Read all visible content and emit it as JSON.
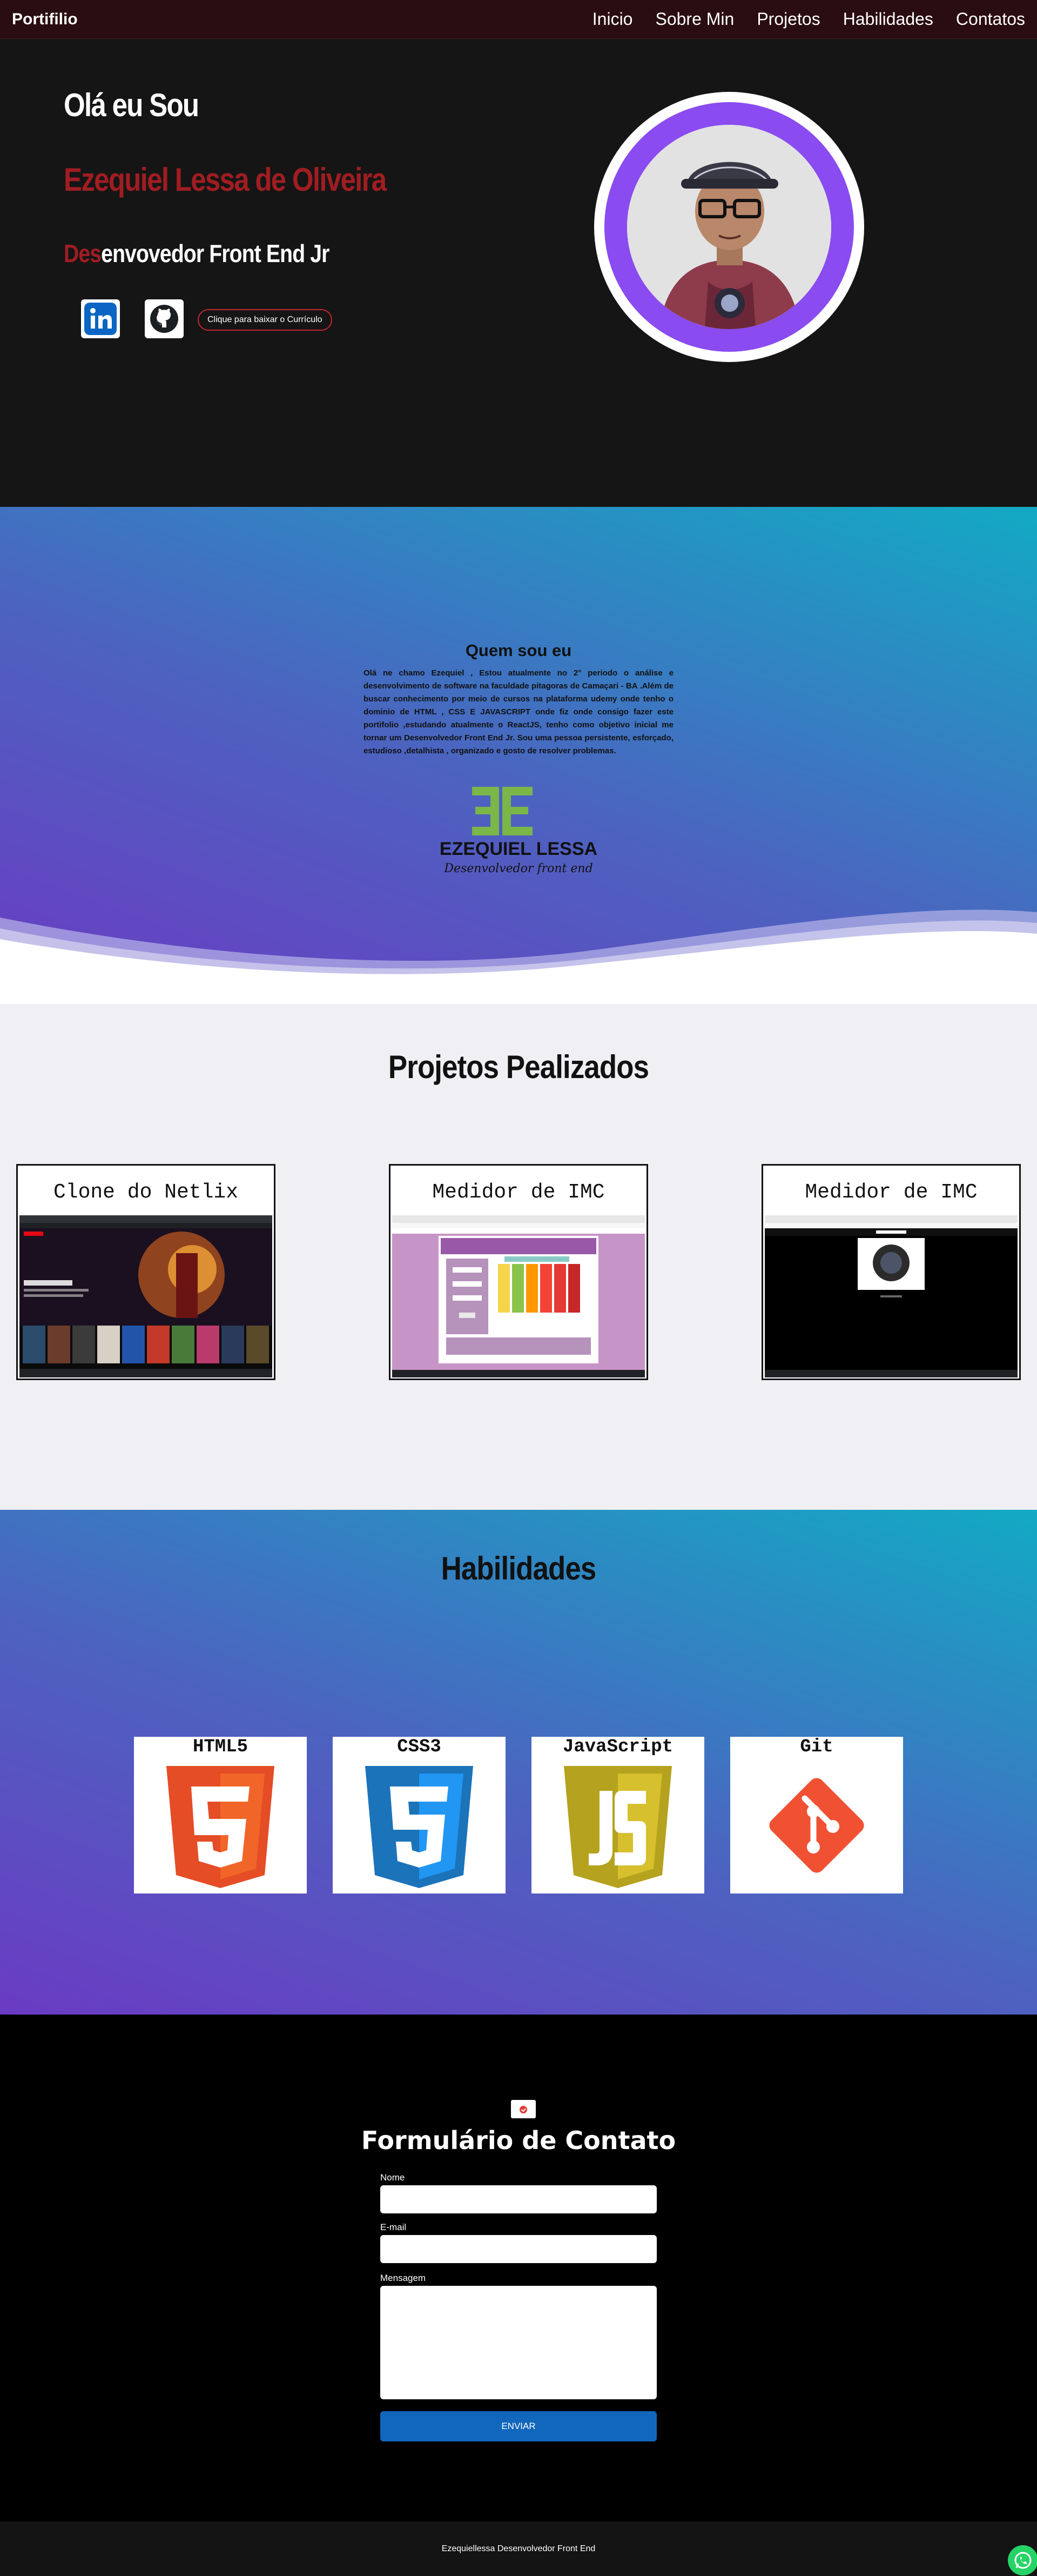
{
  "nav": {
    "brand": "Portifilio",
    "items": [
      {
        "label": "Inicio"
      },
      {
        "label": "Sobre Min"
      },
      {
        "label": "Projetos"
      },
      {
        "label": "Habilidades"
      },
      {
        "label": "Contatos"
      }
    ]
  },
  "hero": {
    "greeting": "Olá eu Sou",
    "name": "Ezequiel Lessa de Oliveira",
    "role_prefix": "Des",
    "role_rest": "envovedor Front End Jr",
    "cv_button": "Clique para baixar o Currículo",
    "social": [
      {
        "icon": "linkedin-icon"
      },
      {
        "icon": "github-icon"
      }
    ],
    "colors": {
      "accent": "#a01d22",
      "ring": "#8a4bf0"
    }
  },
  "about": {
    "title": "Quem sou eu",
    "text": "Olá ne chamo Ezequiel , Estou atualmente no 2° periodo o análise e desenvolvimento de software na faculdade pitagoras de Camaçari - BA .Além de buscar conhecimento por meio de cursos na plataforma udemy onde tenho o dominio de HTML , CSS E JAVASCRIPT onde fiz onde consigo fazer este portifolio ,estudando atualmente o ReactJS, tenho como objetivo inicial me tornar um Desenvolvedor Front End Jr. Sou uma pessoa persistente, esforçado, estudioso ,detalhista , organizado e gosto de resolver problemas.",
    "logo_name": "EZEQUIEL LESSA",
    "logo_tagline": "Desenvolvedor front end"
  },
  "projects": {
    "title": "Projetos Pealizados",
    "items": [
      {
        "title": "Clone do Netlix"
      },
      {
        "title": "Medidor de IMC"
      },
      {
        "title": "Medidor de IMC"
      }
    ]
  },
  "skills": {
    "title": "Habilidades",
    "items": [
      {
        "name": "HTML5",
        "icon": "html5-icon",
        "color": "#e44d26"
      },
      {
        "name": "CSS3",
        "icon": "css3-icon",
        "color": "#2196f3"
      },
      {
        "name": "JavaScript",
        "icon": "javascript-icon",
        "color": "#c9b42a"
      },
      {
        "name": "Git",
        "icon": "git-icon",
        "color": "#f05133"
      }
    ]
  },
  "contact": {
    "title": "Formulário de Contato",
    "name_label": "Nome",
    "email_label": "E-mail",
    "message_label": "Mensagem",
    "submit_label": "ENVIAR"
  },
  "footer": {
    "text": "Ezequiellessa Desenvolvedor Front End"
  }
}
